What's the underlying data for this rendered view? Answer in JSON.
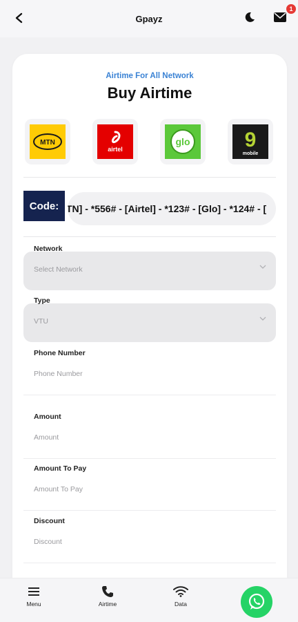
{
  "header": {
    "title": "Gpayz",
    "notification_count": "1"
  },
  "page": {
    "subtitle": "Airtime For All Network",
    "title": "Buy Airtime"
  },
  "networks": [
    {
      "name": "mtn",
      "label": "MTN"
    },
    {
      "name": "airtel",
      "label": "airtel"
    },
    {
      "name": "glo",
      "label": "glo"
    },
    {
      "name": "9mobile",
      "label": "9",
      "sub": "mobile"
    }
  ],
  "code": {
    "label": "Code:",
    "ticker": "TN] - *556# - [Airtel] - *123# - [Glo] - *124# - ["
  },
  "form": {
    "network": {
      "label": "Network",
      "value": "Select Network"
    },
    "type": {
      "label": "Type",
      "value": "VTU"
    },
    "phone": {
      "label": "Phone Number",
      "placeholder": "Phone Number"
    },
    "amount": {
      "label": "Amount",
      "placeholder": "Amount"
    },
    "amount_to_pay": {
      "label": "Amount To Pay",
      "placeholder": "Amount To Pay"
    },
    "discount": {
      "label": "Discount",
      "placeholder": "Discount"
    }
  },
  "bottom_nav": [
    {
      "label": "Menu",
      "icon": "menu-icon"
    },
    {
      "label": "Airtime",
      "icon": "phone-icon"
    },
    {
      "label": "Data",
      "icon": "wifi-icon"
    }
  ],
  "colors": {
    "accent_blue": "#3a82d4",
    "code_bg": "#15234f",
    "whatsapp": "#25d366",
    "badge": "#e53935"
  }
}
